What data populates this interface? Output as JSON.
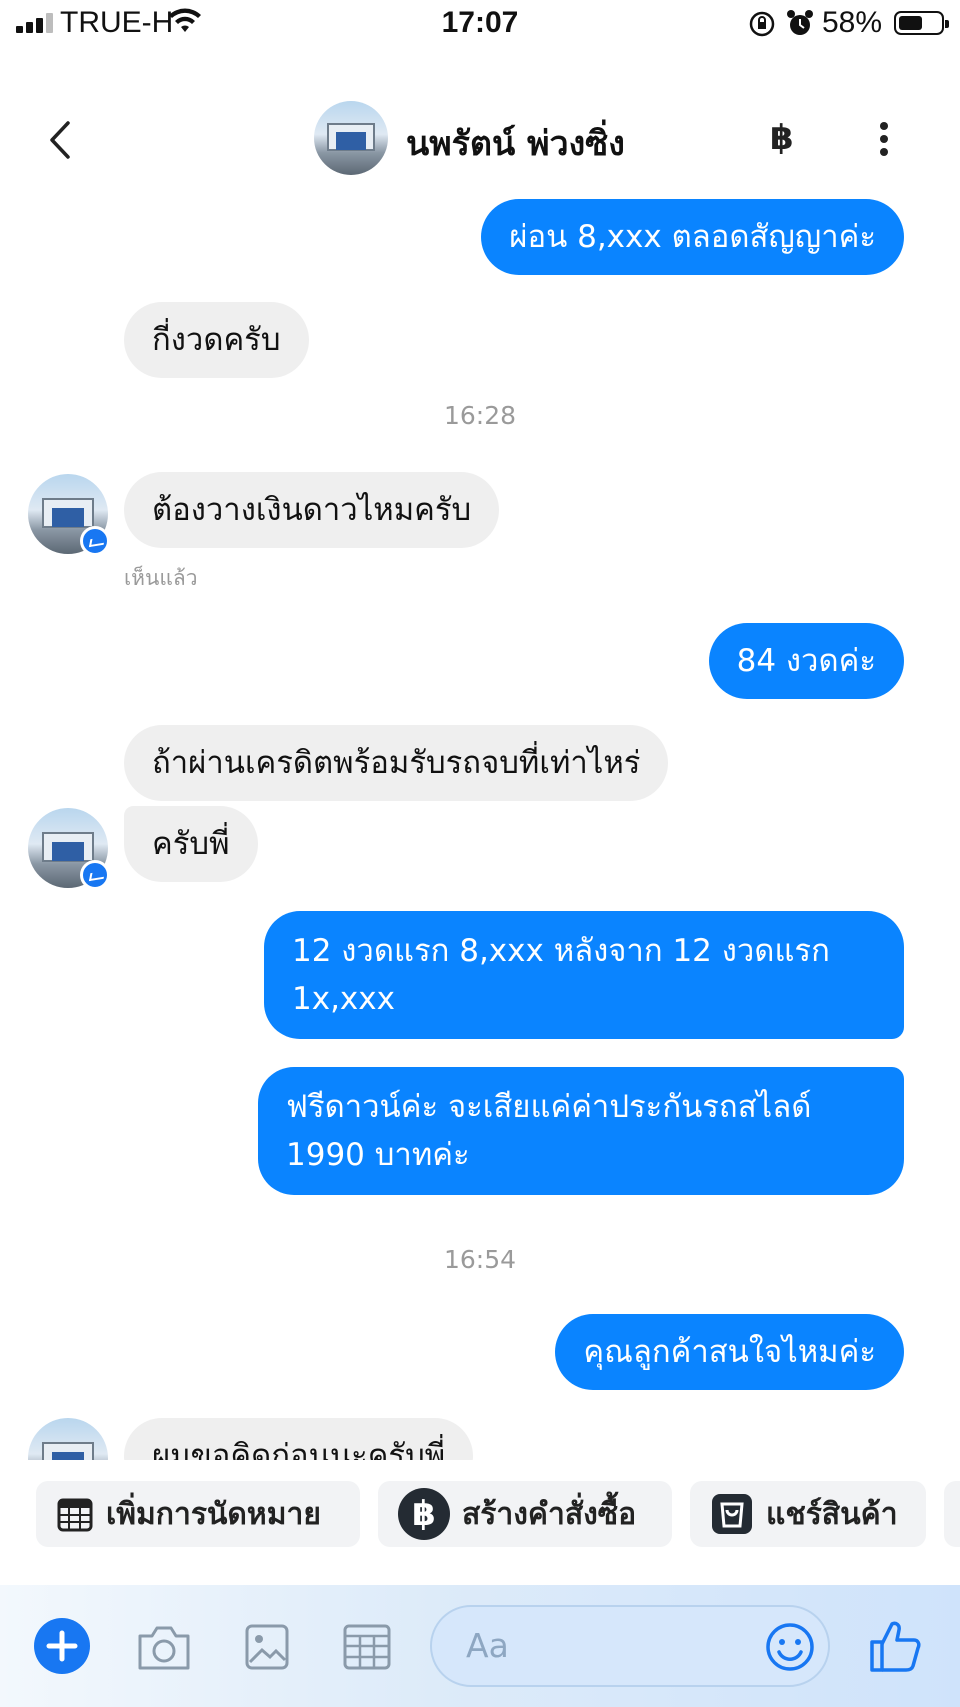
{
  "status_bar": {
    "carrier": "TRUE-H",
    "time": "17:07",
    "battery_percent": "58%",
    "battery_level": 0.58
  },
  "header": {
    "contact_name": "นพรัตน์ พ่วงซิ่ง",
    "baht_icon": "฿"
  },
  "messages": [
    {
      "side": "out",
      "text": "ผ่อน 8,xxx ตลอดสัญญาค่ะ"
    },
    {
      "side": "in",
      "text": "กี่งวดครับ"
    },
    {
      "type": "timestamp",
      "text": "16:28"
    },
    {
      "side": "in",
      "text": "ต้องวางเงินดาวไหมครับ"
    },
    {
      "type": "seen",
      "text": "เห็นแล้ว"
    },
    {
      "side": "out",
      "text": "84 งวดค่ะ"
    },
    {
      "side": "in",
      "text": "ถ้าผ่านเครดิตพร้อมรับรถจบที่เท่าไหร่"
    },
    {
      "side": "in",
      "text": "ครับพี่"
    },
    {
      "side": "out",
      "lines": [
        "12 งวดแรก 8,xxx หลังจาก 12 งวดแรก",
        "1x,xxx"
      ]
    },
    {
      "side": "out",
      "lines": [
        "ฟรีดาวน์ค่ะ จะเสียแค่ค่าประกันรถสไลด์",
        "1990 บาทค่ะ"
      ]
    },
    {
      "type": "timestamp",
      "text": "16:54"
    },
    {
      "side": "out",
      "text": "คุณลูกค้าสนใจไหมค่ะ"
    },
    {
      "side": "in",
      "text": "ผมขอคิดก่อนนะครับพี่",
      "partially_hidden": true
    }
  ],
  "quick_actions": [
    {
      "label": "เพิ่มการนัดหมาย",
      "icon": "calendar-icon"
    },
    {
      "label": "สร้างคำสั่งซื้อ",
      "icon": "baht-icon"
    },
    {
      "label": "แชร์สินค้า",
      "icon": "shopping-bag-icon"
    }
  ],
  "composer": {
    "placeholder": "Aa",
    "icons": [
      "plus-icon",
      "camera-icon",
      "image-icon",
      "table-icon",
      "emoji-icon",
      "thumbs-up-icon"
    ]
  },
  "colors": {
    "accent": "#0a84ff",
    "incoming_bubble": "#efefef",
    "messenger_blue": "#1877f2"
  }
}
